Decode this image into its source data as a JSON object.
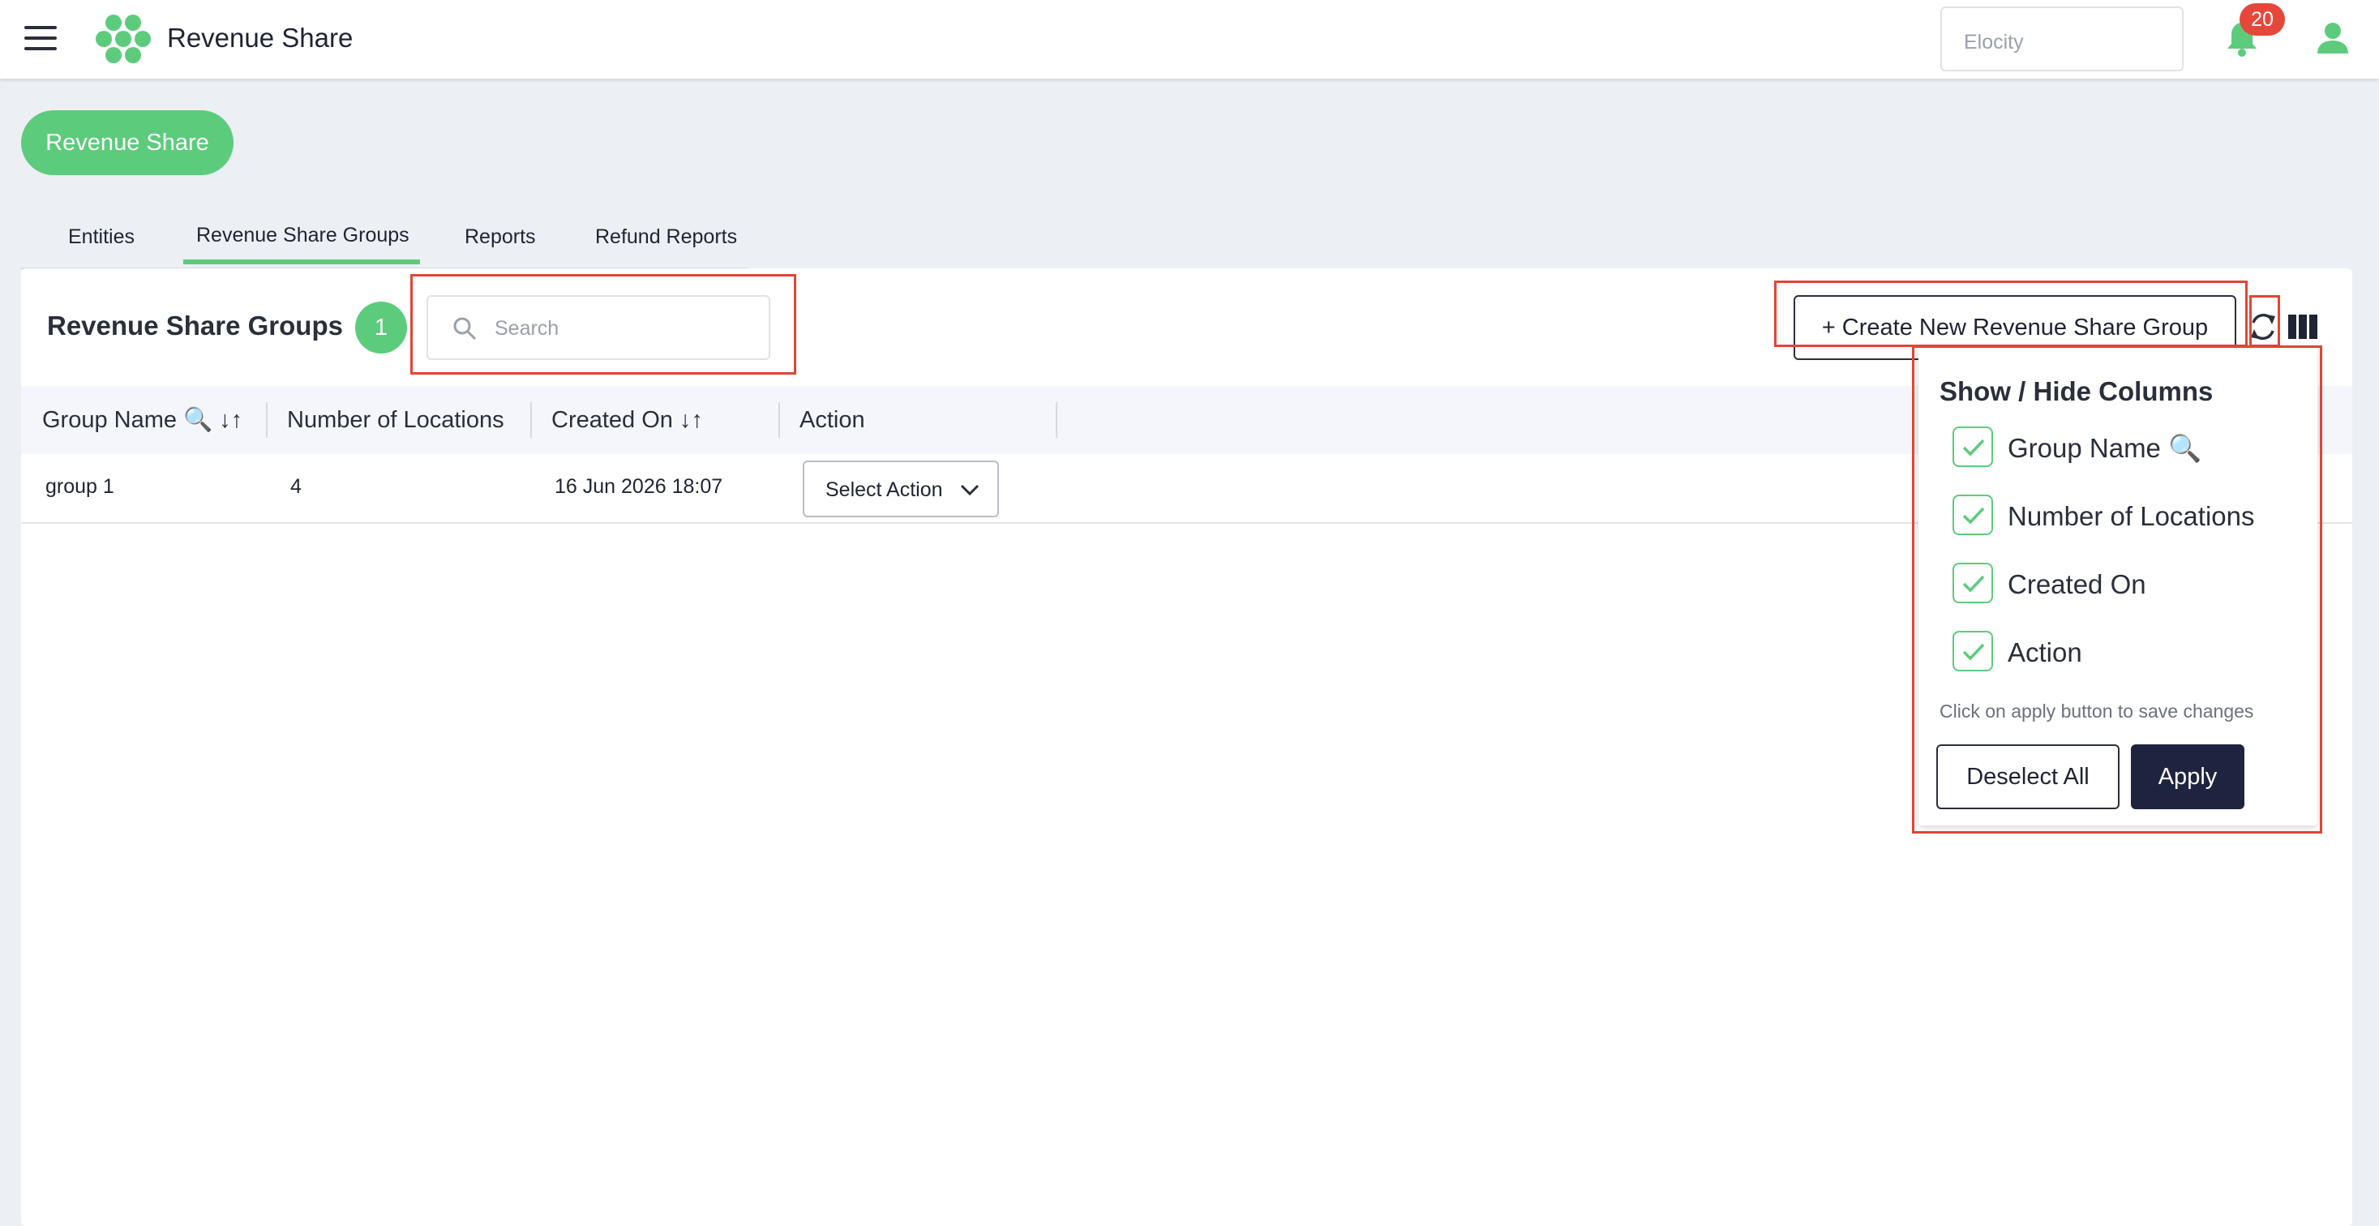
{
  "app": {
    "title": "Revenue Share",
    "org_selector": "Elocity",
    "notification_count": "20",
    "brand_color": "#5ccc7c"
  },
  "header": {
    "pill_label": "Revenue Share"
  },
  "tabs": [
    {
      "label": "Entities"
    },
    {
      "label": "Revenue Share Groups",
      "active": true
    },
    {
      "label": "Reports"
    },
    {
      "label": "Refund Reports"
    }
  ],
  "main": {
    "title": "Revenue Share Groups",
    "count": "1",
    "search_placeholder": "Search",
    "create_button": "+ Create New Revenue Share Group"
  },
  "table": {
    "columns": [
      "Group Name 🔍 ↓↑",
      "Number of Locations",
      "Created On ↓↑",
      "Action"
    ],
    "rows": [
      {
        "group_name": "group 1",
        "locations": "4",
        "created_on": "16 Jun 2026 18:07",
        "action": "Select Action"
      }
    ]
  },
  "columns_panel": {
    "title": "Show / Hide Columns",
    "options": [
      {
        "label": "Group Name 🔍",
        "checked": true
      },
      {
        "label": "Number of Locations",
        "checked": true
      },
      {
        "label": "Created On",
        "checked": true
      },
      {
        "label": "Action",
        "checked": true
      }
    ],
    "hint": "Click on apply button to save changes",
    "deselect_label": "Deselect All",
    "apply_label": "Apply"
  },
  "icons": [
    "menu-icon",
    "logo-icon",
    "bell-icon",
    "user-icon",
    "search-icon",
    "refresh-icon",
    "columns-icon",
    "chevron-down-icon",
    "check-icon"
  ]
}
